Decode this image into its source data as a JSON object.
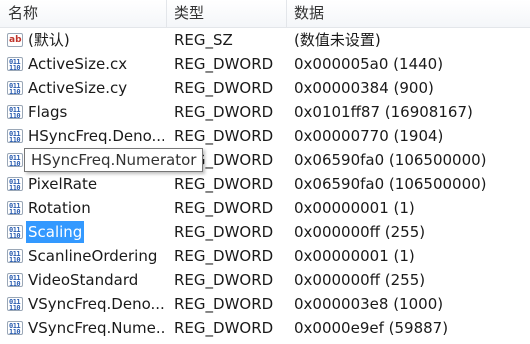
{
  "header": {
    "name": "名称",
    "type": "类型",
    "data": "数据"
  },
  "tooltip": "HSyncFreq.Numerator",
  "rows": [
    {
      "name": "(默认)",
      "type": "REG_SZ",
      "data": "(数值未设置)",
      "icon": "string-value-icon"
    },
    {
      "name": "ActiveSize.cx",
      "type": "REG_DWORD",
      "data": "0x000005a0 (1440)",
      "icon": "binary-value-icon"
    },
    {
      "name": "ActiveSize.cy",
      "type": "REG_DWORD",
      "data": "0x00000384 (900)",
      "icon": "binary-value-icon"
    },
    {
      "name": "Flags",
      "type": "REG_DWORD",
      "data": "0x0101ff87 (16908167)",
      "icon": "binary-value-icon"
    },
    {
      "name": "HSyncFreq.Deno...",
      "type": "REG_DWORD",
      "data": "0x00000770 (1904)",
      "icon": "binary-value-icon"
    },
    {
      "name": "HSyncFreq.Numerator",
      "type": "REG_DWORD",
      "data": "0x06590fa0 (106500000)",
      "icon": "binary-value-icon"
    },
    {
      "name": "PixelRate",
      "type": "REG_DWORD",
      "data": "0x06590fa0 (106500000)",
      "icon": "binary-value-icon"
    },
    {
      "name": "Rotation",
      "type": "REG_DWORD",
      "data": "0x00000001 (1)",
      "icon": "binary-value-icon"
    },
    {
      "name": "Scaling",
      "type": "REG_DWORD",
      "data": "0x000000ff (255)",
      "icon": "binary-value-icon",
      "selected": true
    },
    {
      "name": "ScanlineOrdering",
      "type": "REG_DWORD",
      "data": "0x00000001 (1)",
      "icon": "binary-value-icon"
    },
    {
      "name": "VideoStandard",
      "type": "REG_DWORD",
      "data": "0x000000ff (255)",
      "icon": "binary-value-icon"
    },
    {
      "name": "VSyncFreq.Deno...",
      "type": "REG_DWORD",
      "data": "0x000003e8 (1000)",
      "icon": "binary-value-icon"
    },
    {
      "name": "VSyncFreq.Nume...",
      "type": "REG_DWORD",
      "data": "0x0000e9ef (59887)",
      "icon": "binary-value-icon"
    }
  ],
  "colors": {
    "selection": "#3399ff",
    "header_border": "#e3e6ea"
  }
}
